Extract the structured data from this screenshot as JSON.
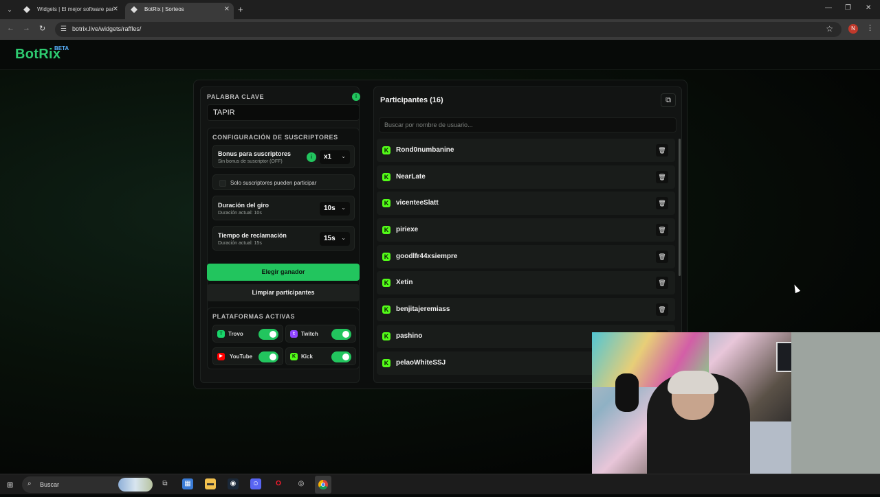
{
  "browser": {
    "tabs": [
      {
        "title": "Widgets | El mejor software par",
        "active": false
      },
      {
        "title": "BotRix | Sorteos",
        "active": true
      }
    ],
    "url": "botrix.live/widgets/raffles/",
    "profile_initial": "N"
  },
  "site": {
    "logo": "BotRix",
    "logo_badge": "BETA",
    "accent_color": "#22c55e"
  },
  "left_panel": {
    "keyword_title": "PALABRA CLAVE",
    "keyword_value": "TAPIR",
    "subs_config": {
      "title": "CONFIGURACIÓN DE SUSCRIPTORES",
      "bonus_title": "Bonus para suscriptores",
      "bonus_sub": "Sin bonus de suscriptor (OFF)",
      "bonus_value": "x1",
      "only_subs_label": "Solo suscriptores pueden participar",
      "only_subs_checked": false,
      "spin_title": "Duración del giro",
      "spin_sub": "Duración actual: 10s",
      "spin_value": "10s",
      "claim_title": "Tiempo de reclamación",
      "claim_sub": "Duración actual: 15s",
      "claim_value": "15s"
    },
    "pick_winner": "Elegir ganador",
    "clear_participants": "Limpiar participantes",
    "platforms": {
      "title": "PLATAFORMAS ACTIVAS",
      "items": [
        {
          "name": "Trovo",
          "enabled": true,
          "color": "#19d66b"
        },
        {
          "name": "Twitch",
          "enabled": true,
          "color": "#9146ff"
        },
        {
          "name": "YouTube",
          "enabled": true,
          "color": "#ff0000"
        },
        {
          "name": "Kick",
          "enabled": true,
          "color": "#53fc18"
        }
      ]
    }
  },
  "right_panel": {
    "title": "Participantes (16)",
    "search_placeholder": "Buscar por nombre de usuario...",
    "participants": [
      "Rond0numbanine",
      "NearLate",
      "vicenteeSlatt",
      "piriexe",
      "goodlfr44xsiempre",
      "Xetin",
      "benjitajeremiass",
      "pashino",
      "pelaoWhiteSSJ"
    ]
  },
  "taskbar": {
    "search_label": "Buscar"
  }
}
